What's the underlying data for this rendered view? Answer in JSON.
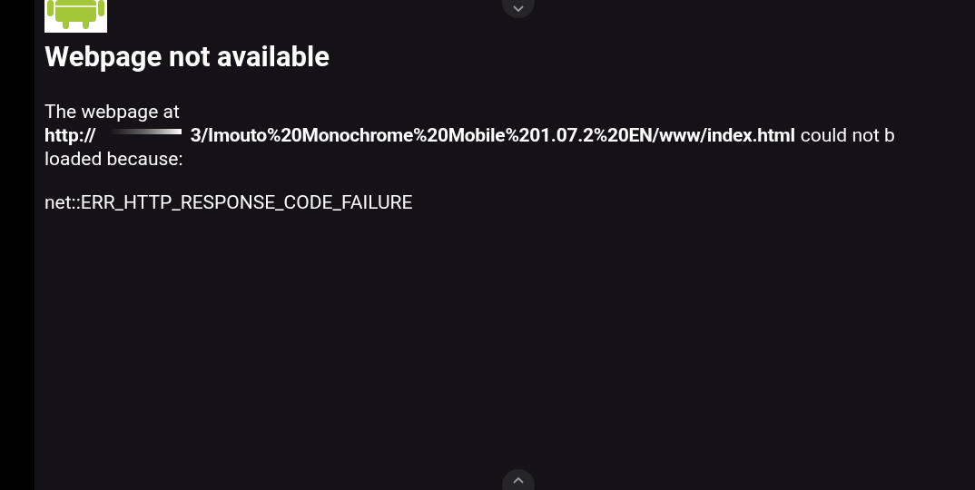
{
  "heading": "Webpage not available",
  "message": {
    "intro": "The webpage at",
    "url_prefix": "http://",
    "url_rest": "3/Imouto%20Monochrome%20Mobile%201.07.2%20EN/www/index.html",
    "continuation": "could not b",
    "ending": "loaded because:"
  },
  "error_code": "net::ERR_HTTP_RESPONSE_CODE_FAILURE"
}
